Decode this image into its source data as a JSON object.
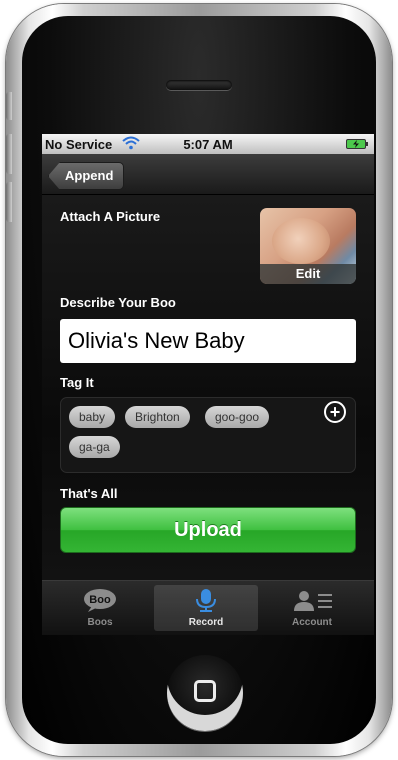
{
  "status_bar": {
    "carrier": "No Service",
    "time": "5:07 AM"
  },
  "nav": {
    "back_label": "Append"
  },
  "attach": {
    "label": "Attach A Picture",
    "edit_label": "Edit"
  },
  "describe": {
    "label": "Describe Your Boo",
    "value": "Olivia's New Baby"
  },
  "tags": {
    "label": "Tag It",
    "items": [
      "baby",
      "Brighton",
      "goo-goo",
      "ga-ga"
    ],
    "add_icon": "plus-circle-icon"
  },
  "finish": {
    "label": "That's All",
    "upload_label": "Upload"
  },
  "tabs": [
    {
      "icon_text": "Boo",
      "label": "Boos",
      "active": false
    },
    {
      "icon": "microphone-icon",
      "label": "Record",
      "active": true
    },
    {
      "icon": "account-icon",
      "label": "Account",
      "active": false
    }
  ],
  "colors": {
    "upload_green": "#3fc040",
    "record_blue": "#3a8de0"
  }
}
